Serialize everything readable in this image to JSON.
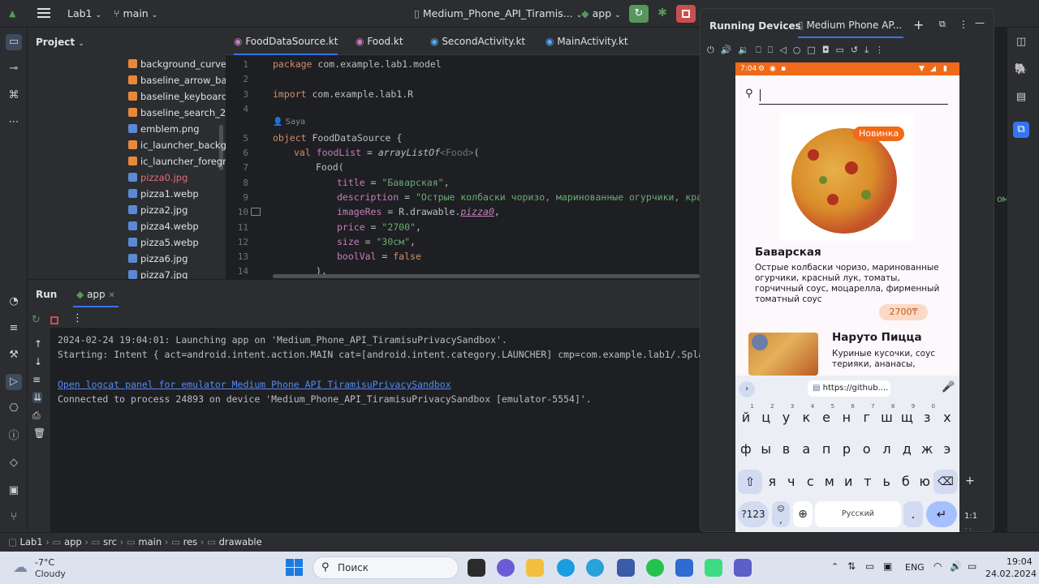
{
  "titlebar": {
    "project": "Lab1",
    "branch": "main",
    "device": "Medium_Phone_API_Tiramis...",
    "run_config": "app"
  },
  "project_panel": {
    "title": "Project",
    "files": [
      {
        "name": "background_curve.xm",
        "type": "xml"
      },
      {
        "name": "baseline_arrow_back",
        "type": "xml"
      },
      {
        "name": "baseline_keyboard_a",
        "type": "xml"
      },
      {
        "name": "baseline_search_24.:",
        "type": "xml"
      },
      {
        "name": "emblem.png",
        "type": "img"
      },
      {
        "name": "ic_launcher_backgro",
        "type": "xml"
      },
      {
        "name": "ic_launcher_foregrou",
        "type": "xml"
      },
      {
        "name": "pizza0.jpg",
        "type": "img-err"
      },
      {
        "name": "pizza1.webp",
        "type": "img"
      },
      {
        "name": "pizza2.jpg",
        "type": "img"
      },
      {
        "name": "pizza4.webp",
        "type": "img"
      },
      {
        "name": "pizza5.webp",
        "type": "img"
      },
      {
        "name": "pizza6.jpg",
        "type": "img"
      },
      {
        "name": "pizza7.jpg",
        "type": "img"
      }
    ]
  },
  "editor": {
    "tabs": [
      "FoodDataSource.kt",
      "Food.kt",
      "SecondActivity.kt",
      "MainActivity.kt"
    ],
    "author_hint": "Saya",
    "lines": [
      "1",
      "2",
      "3",
      "4",
      "5",
      "6",
      "7",
      "8",
      "9",
      "10",
      "11",
      "12",
      "13",
      "14"
    ],
    "code": {
      "l1_kw": "package",
      "l1_rest": " com.example.lab1.model",
      "l3_kw": "import",
      "l3_rest": " com.example.lab1.R",
      "l5_kw": "object",
      "l5_rest": " FoodDataSource {",
      "l6_kw": "val",
      "l6_prop": " foodList",
      "l6_eq": " = ",
      "l6_fn": "arrayListOf",
      "l6_gen": "<Food>",
      "l6_end": "(",
      "l7": "Food(",
      "l8_prop": "title",
      "l8_eq": " = ",
      "l8_str": "\"Баварская\"",
      "l8_end": ",",
      "l9_prop": "description",
      "l9_eq": " = ",
      "l9_str": "\"Острые колбаски чоризо, маринованные огурчики, красн",
      "l9_tail": "омат",
      "l10_prop": "imageRes",
      "l10_eq": " = R.drawable.",
      "l10_val": "pizza0",
      "l10_end": ",",
      "l11_prop": "price",
      "l11_eq": " = ",
      "l11_str": "\"2700\"",
      "l11_end": ",",
      "l12_prop": "size",
      "l12_eq": " = ",
      "l12_str": "\"30см\"",
      "l12_end": ",",
      "l13_prop": "boolVal",
      "l13_eq": " = ",
      "l13_kw": "false",
      "l14": "),"
    }
  },
  "run": {
    "title": "Run",
    "tab": "app",
    "lines": [
      "2024-02-24 19:04:01: Launching app on 'Medium_Phone_API_TiramisuPrivacySandbox'.",
      "Starting: Intent { act=android.intent.action.MAIN cat=[android.intent.category.LAUNCHER] cmp=com.example.lab1/.SplashAc",
      "Connected to process 24893 on device 'Medium_Phone_API_TiramisuPrivacySandbox [emulator-5554]'."
    ],
    "link": "Open logcat panel for emulator Medium Phone API TiramisuPrivacySandbox"
  },
  "devices": {
    "title": "Running Devices",
    "tab": "Medium Phone AP..."
  },
  "phone": {
    "time": "7:04",
    "items": [
      {
        "badge": "Новинка",
        "title": "Баварская",
        "description": "Острые колбаски чоризо, маринованные огурчики, красный лук, томаты, горчичный соус, моцарелла, фирменный томатный соус",
        "price": "2700₸"
      },
      {
        "title": "Наруто Пицца",
        "description": "Куриные кусочки, соус терияки, ананасы,"
      }
    ],
    "keyboard": {
      "suggestion": "https://github....",
      "row1": [
        "й",
        "ц",
        "у",
        "к",
        "е",
        "н",
        "г",
        "ш",
        "щ",
        "з",
        "х"
      ],
      "row1_sup": [
        "1",
        "2",
        "3",
        "4",
        "5",
        "6",
        "7",
        "8",
        "9",
        "0",
        ""
      ],
      "row2": [
        "ф",
        "ы",
        "в",
        "а",
        "п",
        "р",
        "о",
        "л",
        "д",
        "ж",
        "э"
      ],
      "row3": [
        "я",
        "ч",
        "с",
        "м",
        "и",
        "т",
        "ь",
        "б",
        "ю"
      ],
      "symbols": "?123",
      "comma": ",",
      "space": "Русский",
      "period": "."
    },
    "zoom": "1:1"
  },
  "breadcrumb": [
    "Lab1",
    "app",
    "src",
    "main",
    "res",
    "drawable"
  ],
  "taskbar": {
    "weather_temp": "-7°C",
    "weather_desc": "Cloudy",
    "search": "Поиск",
    "lang": "ENG",
    "time": "19:04",
    "date": "24.02.2024"
  }
}
